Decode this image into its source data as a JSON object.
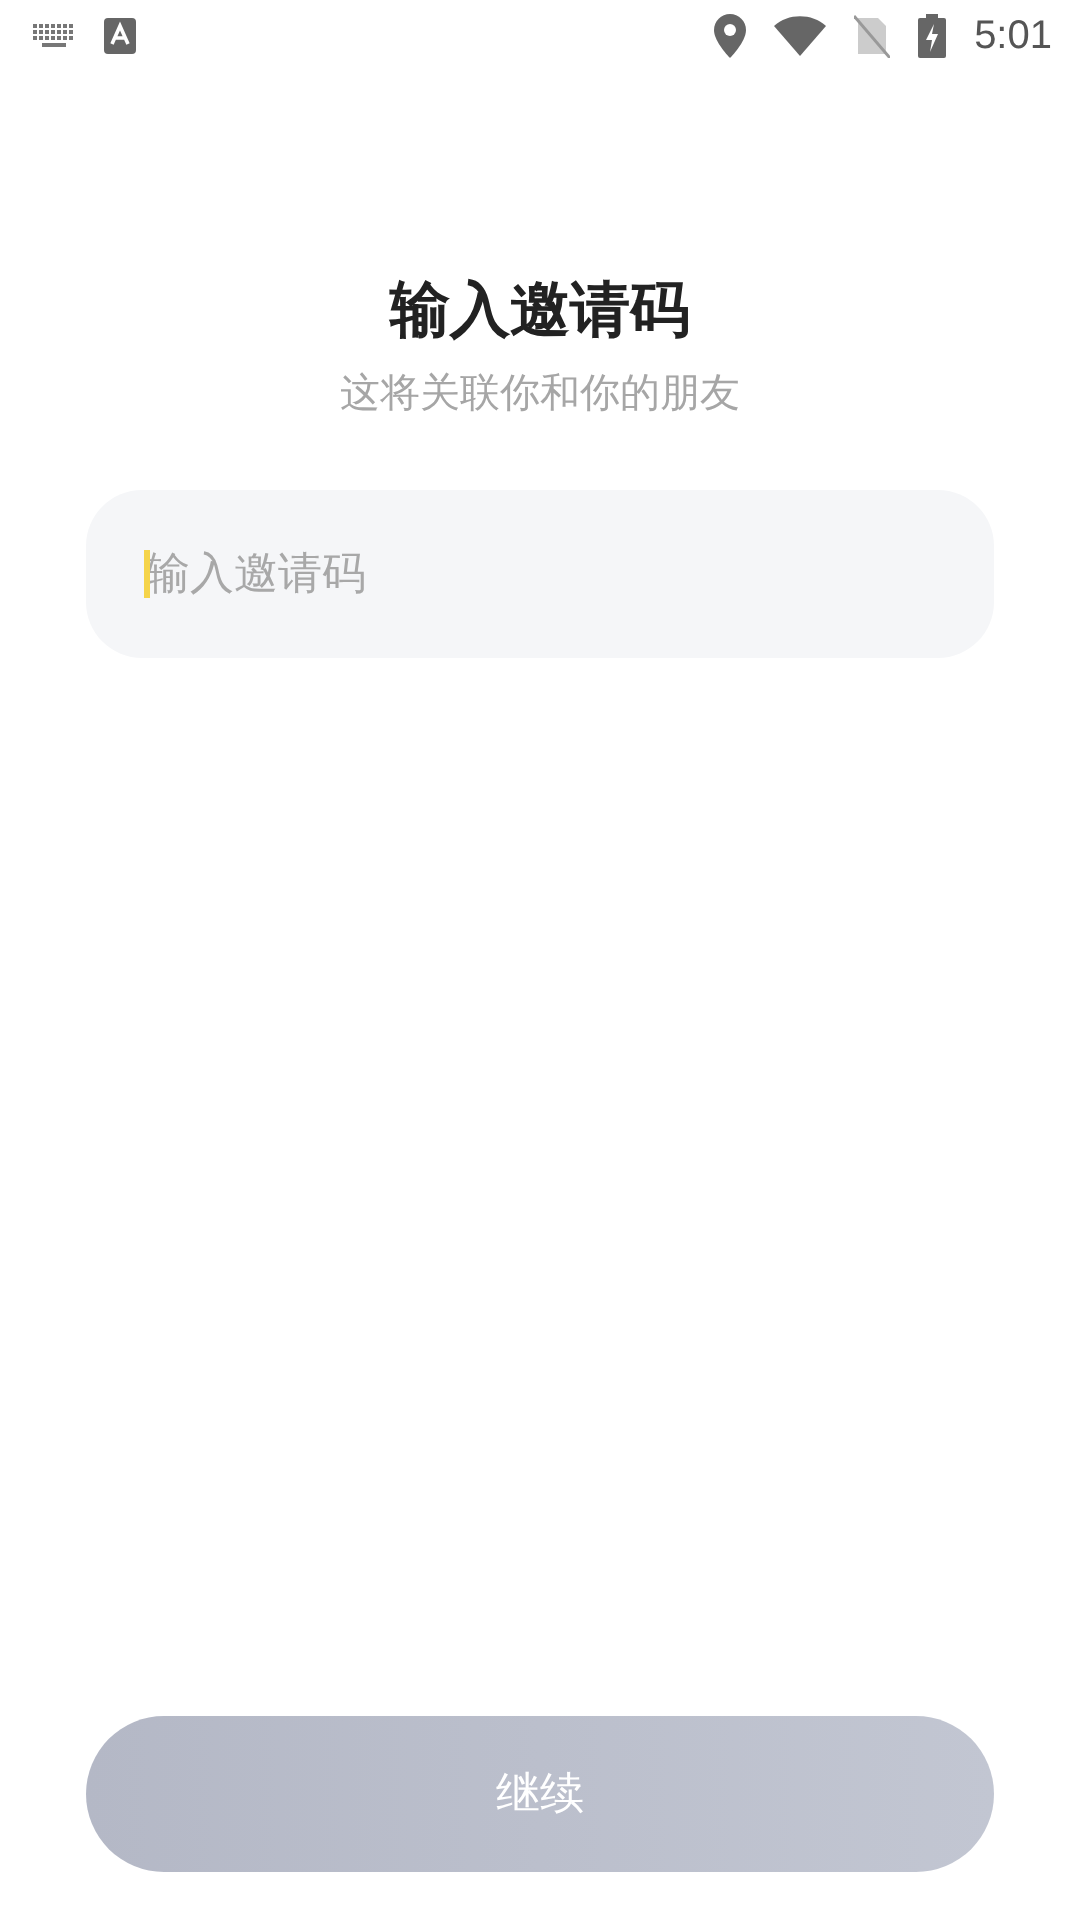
{
  "status_bar": {
    "time": "5:01"
  },
  "title": "输入邀请码",
  "subtitle": "这将关联你和你的朋友",
  "invite_field": {
    "placeholder": "输入邀请码",
    "focused": true
  },
  "continue_button": {
    "label": "继续",
    "disabled": true
  }
}
